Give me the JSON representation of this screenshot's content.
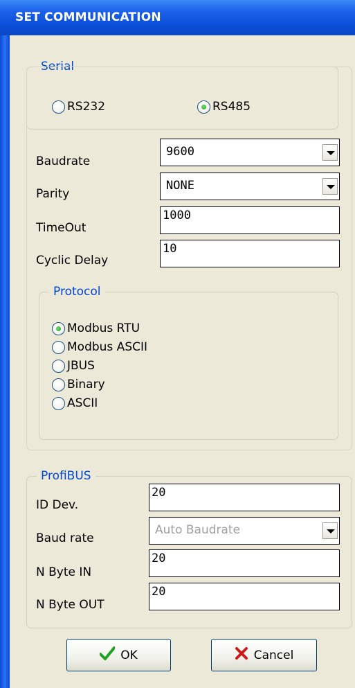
{
  "window": {
    "title": "SET COMMUNICATION"
  },
  "serial": {
    "legend": "Serial",
    "options": [
      {
        "label": "RS232",
        "checked": false
      },
      {
        "label": "RS485",
        "checked": true
      }
    ],
    "fields": {
      "baudrate": {
        "label": "Baudrate",
        "value": "9600"
      },
      "parity": {
        "label": "Parity",
        "value": "NONE"
      },
      "timeout": {
        "label": "TimeOut",
        "value": "1000"
      },
      "cyclic_delay": {
        "label": "Cyclic Delay",
        "value": "10"
      }
    }
  },
  "protocol": {
    "legend": "Protocol",
    "options": [
      {
        "label": "Modbus RTU",
        "checked": true
      },
      {
        "label": "Modbus ASCII",
        "checked": false
      },
      {
        "label": "JBUS",
        "checked": false
      },
      {
        "label": "Binary",
        "checked": false
      },
      {
        "label": "ASCII",
        "checked": false
      }
    ]
  },
  "profibus": {
    "legend": "ProfiBUS",
    "fields": {
      "id_dev": {
        "label": "ID Dev.",
        "value": "20"
      },
      "baud_rate": {
        "label": "Baud rate",
        "value": "Auto Baudrate"
      },
      "n_byte_in": {
        "label": "N Byte IN",
        "value": "20"
      },
      "n_byte_out": {
        "label": "N Byte OUT",
        "value": "20"
      }
    }
  },
  "buttons": {
    "ok": "OK",
    "cancel": "Cancel"
  },
  "colors": {
    "title_bar": "#0a47c8",
    "legend_text": "#0046d5",
    "check_green": "#21a121",
    "cancel_red": "#cc1a1a"
  }
}
